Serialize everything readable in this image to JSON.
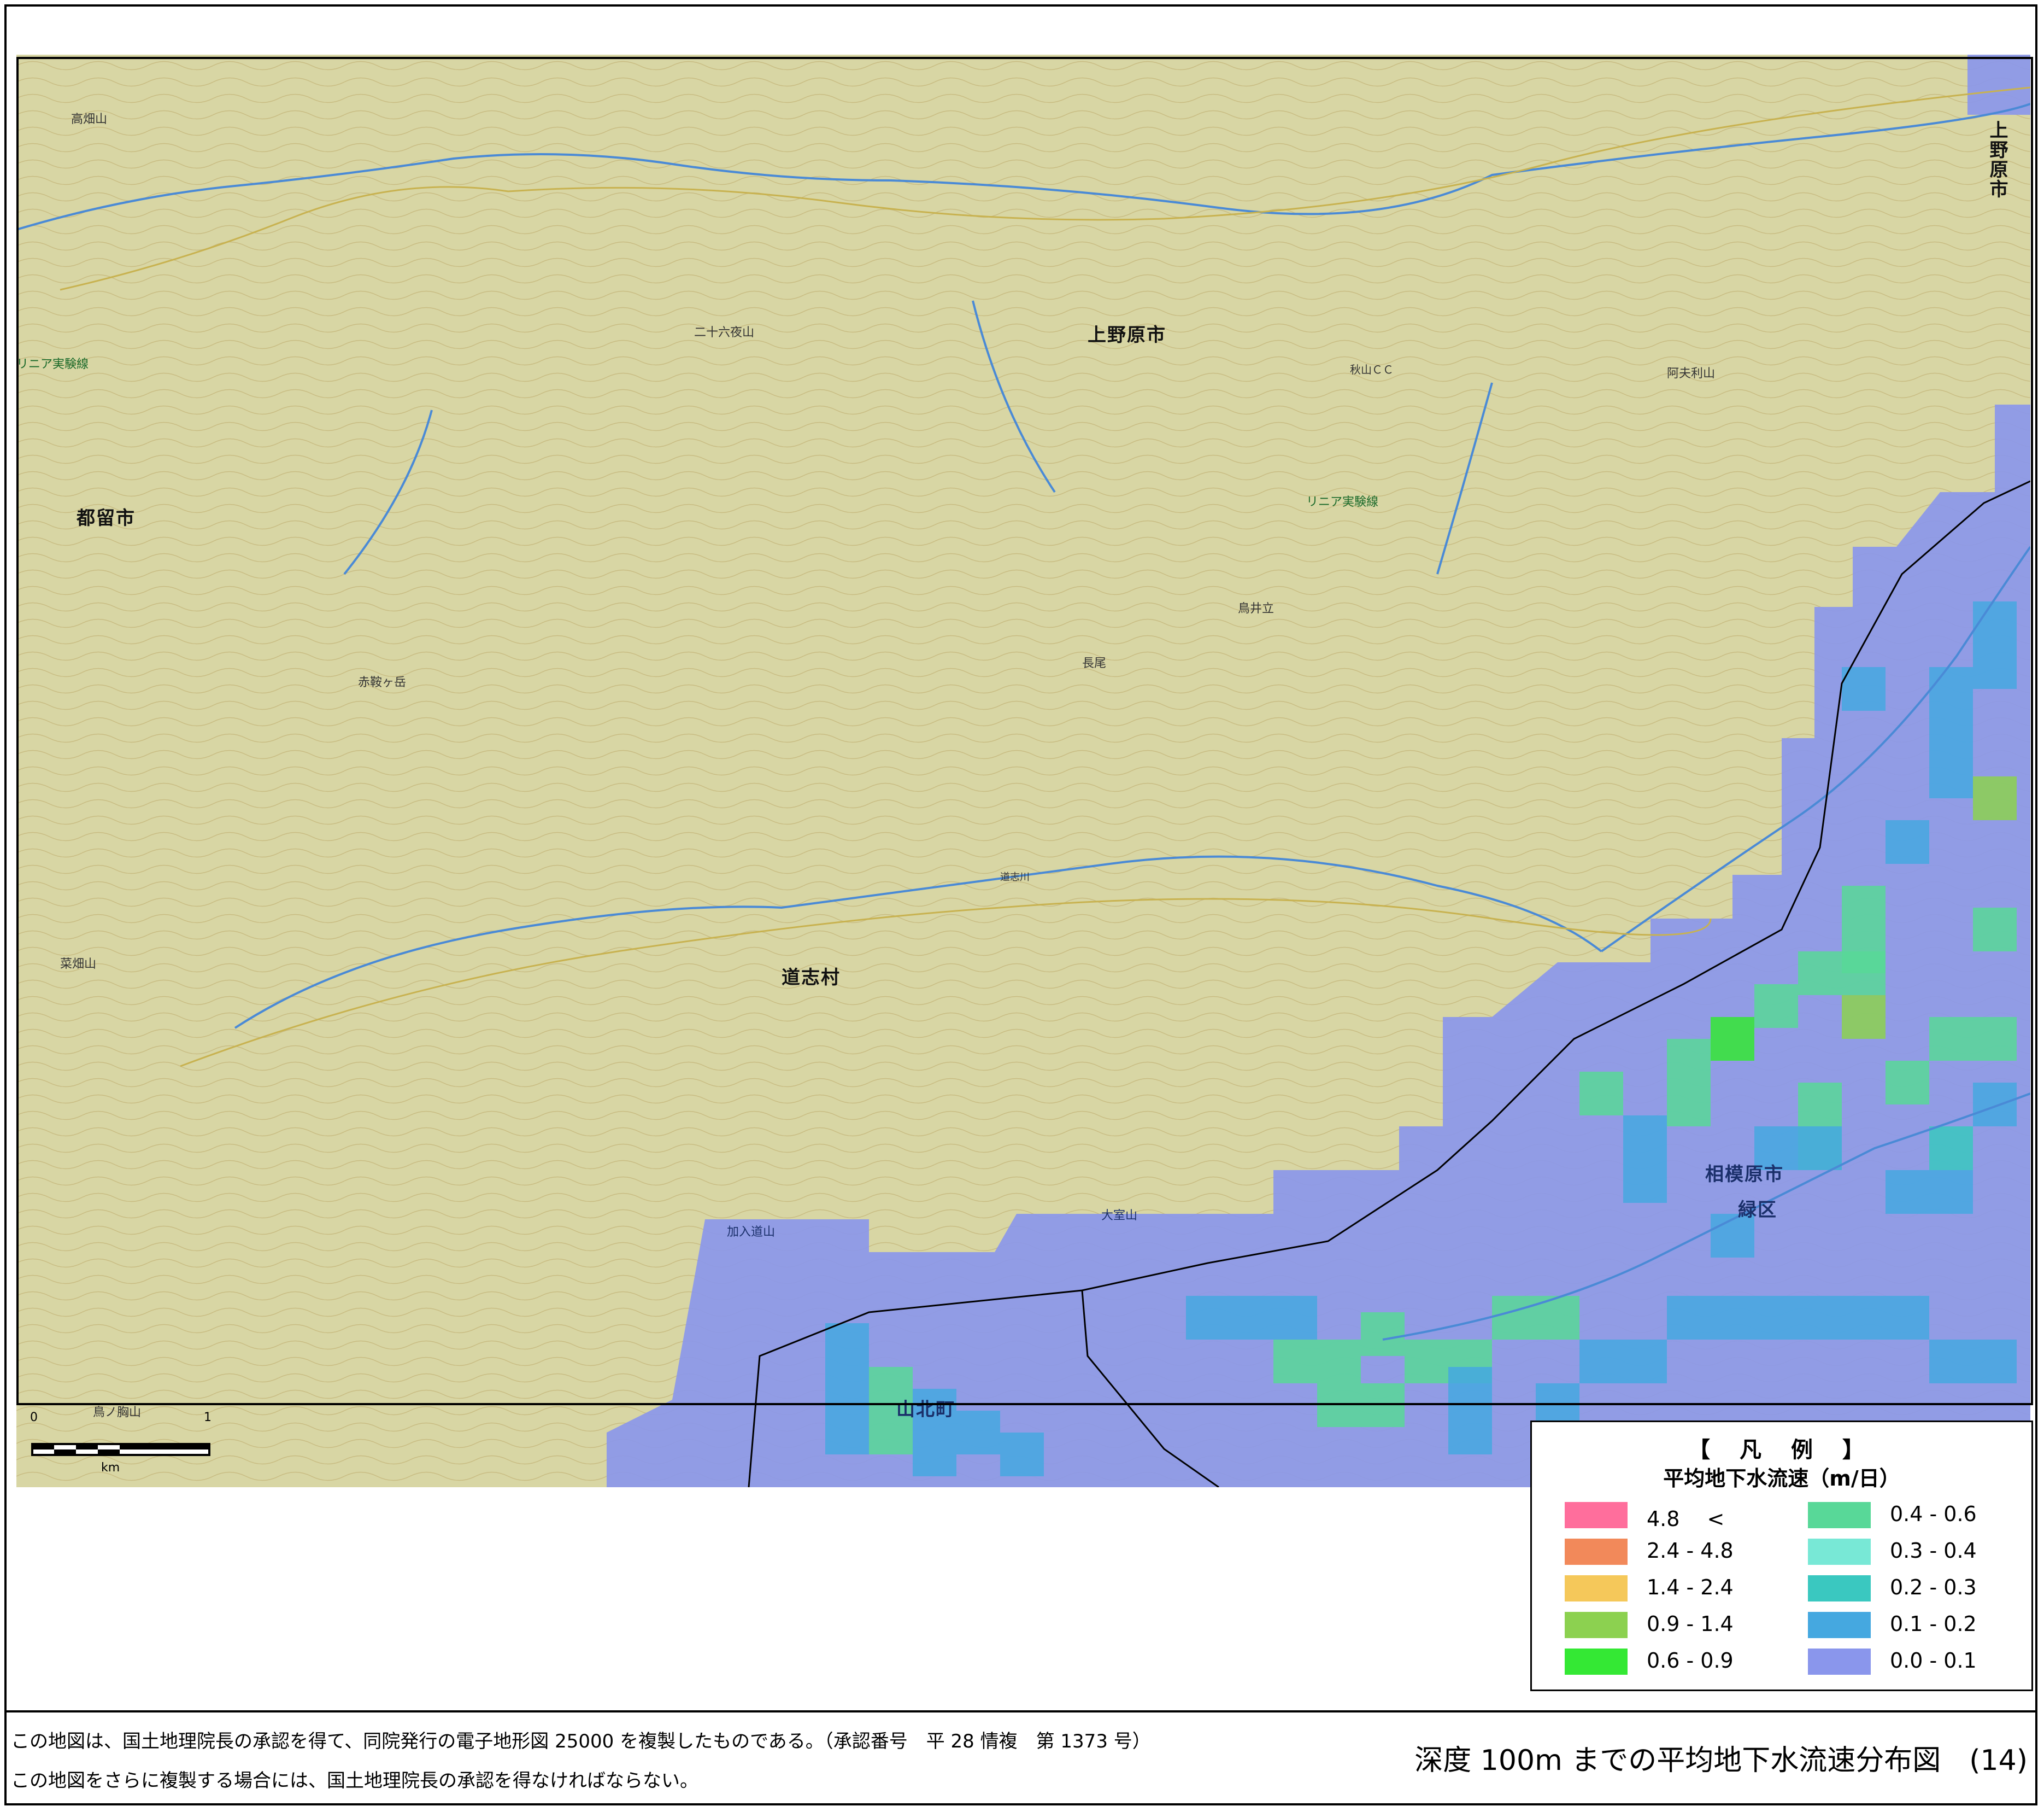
{
  "map": {
    "place_names": {
      "uenohara_east": "上野原市",
      "uenohara_center": "上野原市",
      "tsuru": "都留市",
      "doshi": "道志村",
      "sagamihara": "相模原市",
      "midori": "緑区",
      "yamakita": "山北町"
    },
    "mountains": {
      "takahata": "高畑山",
      "nijurokuya": "二十六夜山",
      "abura": "阿夫利山",
      "akabokke": "赤鞍ヶ岳",
      "nagao": "長尾",
      "karasuidate": "鳥井立",
      "kikuhata": "菜畑山",
      "kanyudo": "加入道山",
      "omuro": "大室山",
      "karasunobo": "鳥ノ胸山"
    },
    "rail_labels": {
      "linear_left": "リニア実験線",
      "linear_center": "リニア実験線"
    },
    "small_labels": {
      "akiyama_cc": "秋山ＣＣ",
      "doshi_gawa": "道志川"
    },
    "colors": {
      "topo_base": "#d8d6a4",
      "contour": "#b39a58",
      "river": "#4a8ad6",
      "road": "#f2f0c8",
      "boundary": "#000000"
    },
    "overlay_note": "groundwater velocity grid shown in the southeast part of the map"
  },
  "scale_bar": {
    "start": "0",
    "end": "1",
    "unit": "km"
  },
  "legend": {
    "title": "【 凡 例 】",
    "subtitle": "平均地下水流速（m/日）",
    "items": [
      {
        "label": "4.8 　<",
        "color": "#ff6e9c"
      },
      {
        "label": "2.4 - 4.8",
        "color": "#f2895a"
      },
      {
        "label": "1.4 - 2.4",
        "color": "#f5c85a"
      },
      {
        "label": "0.9 - 1.4",
        "color": "#8cd150"
      },
      {
        "label": "0.6 - 0.9",
        "color": "#34e834"
      },
      {
        "label": "0.4 - 0.6",
        "color": "#58d898"
      },
      {
        "label": "0.3 - 0.4",
        "color": "#78e8d6"
      },
      {
        "label": "0.2 - 0.3",
        "color": "#3ac8c0"
      },
      {
        "label": "0.1 - 0.2",
        "color": "#45a8e0"
      },
      {
        "label": "0.0 - 0.1",
        "color": "#8a96ec"
      }
    ]
  },
  "footer": {
    "note_1": "この地図は、国土地理院長の承認を得て、同院発行の電子地形図 25000 を複製したものである。（承認番号　平 28 情複　第 1373 号）",
    "note_2": "この地図をさらに複製する場合には、国土地理院長の承認を得なければならない。",
    "title": "深度 100m までの平均地下水流速分布図　(14)"
  }
}
